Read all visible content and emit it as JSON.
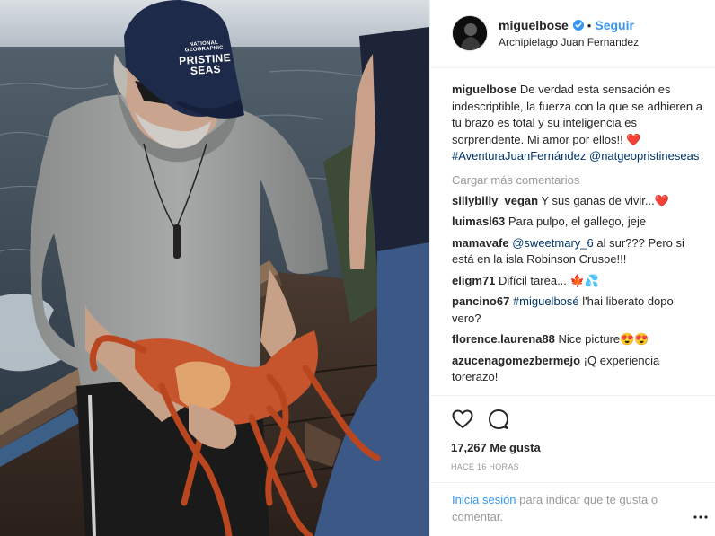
{
  "photo": {
    "cap_brand": "NATIONAL GEOGRAPHIC",
    "cap_title": "PRISTINE",
    "cap_sub": "SEAS"
  },
  "header": {
    "username": "miguelbose",
    "follow_label": "Seguir",
    "separator": "•",
    "location": "Archipielago Juan Fernandez"
  },
  "caption": {
    "username": "miguelbose",
    "text": "De verdad esta sensación es indescriptible, la fuerza con la que se adhieren a tu brazo es total y su inteligencia es sorprendente. Mi amor por ellos!!",
    "emoji": "❤️",
    "hashtag": "#AventuraJuanFernández",
    "mention": "@natgeopristineseas"
  },
  "load_more": "Cargar más comentarios",
  "comments": [
    {
      "user": "sillybilly_vegan",
      "text": "Y sus ganas de vivir...❤️"
    },
    {
      "user": "luimasl63",
      "text": "Para pulpo, el gallego, jeje"
    },
    {
      "user": "mamavafe",
      "mention": "@sweetmary_6",
      "text": " al sur??? Pero si está en la isla Robinson Crusoe!!!"
    },
    {
      "user": "eligm71",
      "text": "Difícil tarea... 🍁💦"
    },
    {
      "user": "pancino67",
      "mention": "#miguelbosé",
      "text": " l'hai liberato dopo vero?"
    },
    {
      "user": "florence.laurena88",
      "text": "Nice picture😍😍"
    },
    {
      "user": "azucenagomezbermejo",
      "text": "¡Q experiencia torerazo!"
    }
  ],
  "actions": {
    "likes": "17,267 Me gusta",
    "time": "HACE 16 HORAS"
  },
  "footer": {
    "login_label": "Inicia sesión",
    "text": " para indicar que te gusta o comentar.",
    "more_label": "..."
  },
  "colors": {
    "accent": "#3897f0",
    "link": "#003569",
    "heart": "#ed4956",
    "muted": "#999999"
  }
}
